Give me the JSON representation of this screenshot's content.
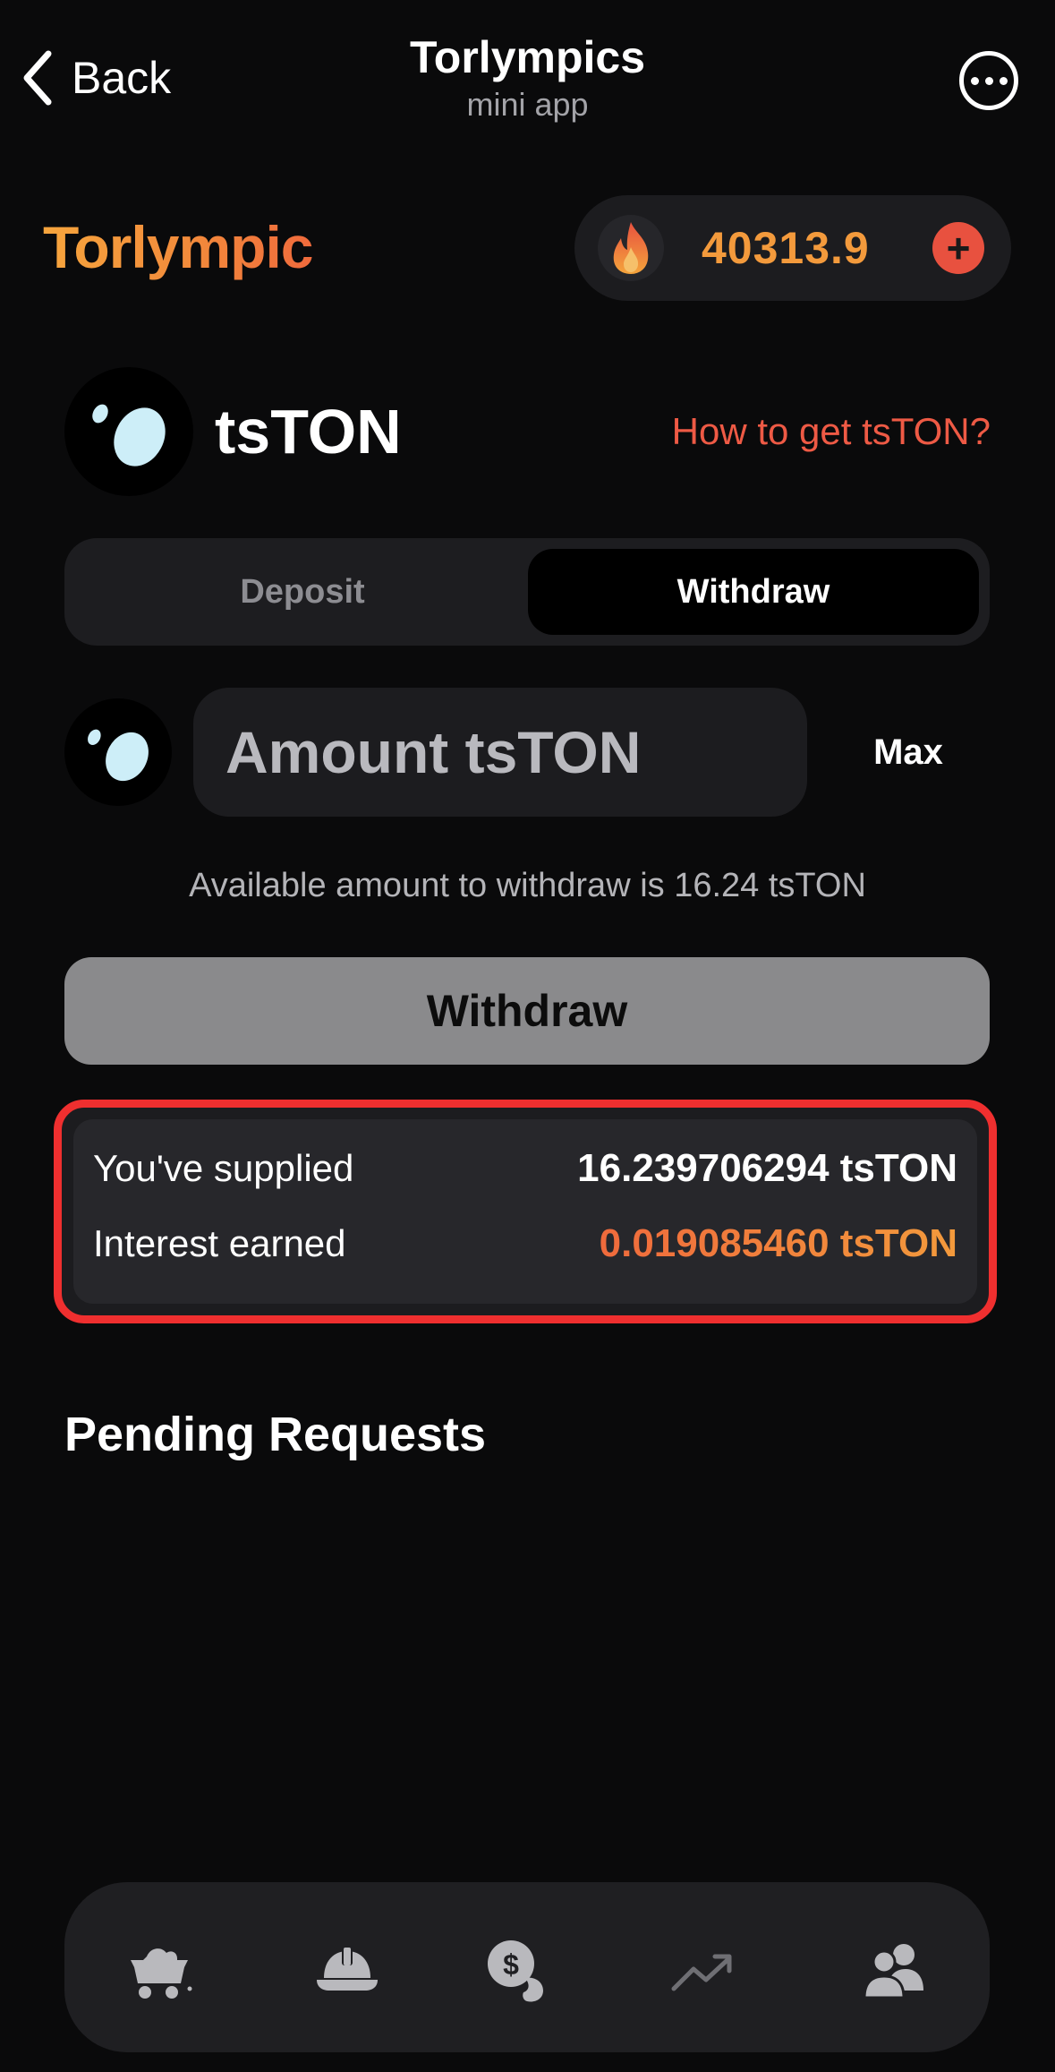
{
  "nav": {
    "back_label": "Back",
    "title": "Torlympics",
    "subtitle": "mini app"
  },
  "header": {
    "brand": "Torlympic",
    "balance": "40313.9",
    "add_label": "+"
  },
  "token": {
    "name": "tsTON",
    "how_to_link": "How to get tsTON?"
  },
  "tabs": {
    "deposit_label": "Deposit",
    "withdraw_label": "Withdraw",
    "selected": "Withdraw"
  },
  "amount": {
    "placeholder": "Amount tsTON",
    "value": "",
    "max_label": "Max",
    "available_note": "Available amount to withdraw is 16.24 tsTON"
  },
  "withdraw_button": {
    "label": "Withdraw"
  },
  "supply": {
    "supplied_label": "You've supplied",
    "supplied_value": "16.239706294 tsTON",
    "interest_label": "Interest earned",
    "interest_value": "0.019085460 tsTON"
  },
  "pending": {
    "title": "Pending Requests"
  },
  "bottom_nav": {
    "items": [
      {
        "icon": "mine-cart-icon"
      },
      {
        "icon": "hard-hat-icon"
      },
      {
        "icon": "coins-icon"
      },
      {
        "icon": "trending-up-icon"
      },
      {
        "icon": "users-icon"
      }
    ]
  },
  "colors": {
    "background": "#0a0a0b",
    "accent_orange": "#f39a3c",
    "accent_red": "#ee5a45",
    "highlight_border": "#ef2f2f",
    "token_blue": "#cdeef8"
  }
}
